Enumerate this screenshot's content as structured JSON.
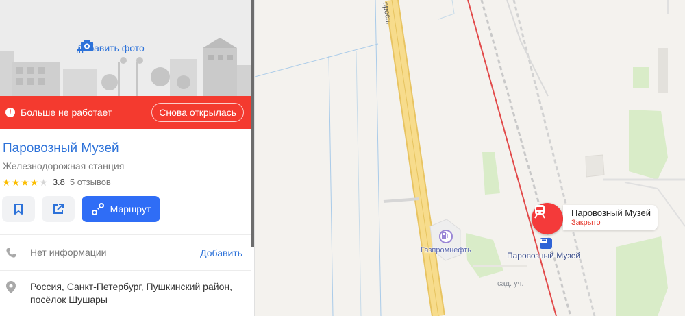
{
  "panel": {
    "add_photo": "Добавить фото",
    "status": {
      "closed_text": "Больше не работает",
      "reopened_button": "Снова открылась"
    },
    "title": "Паровозный Музей",
    "category": "Железнодорожная станция",
    "rating": {
      "value": "3.8",
      "stars_filled": 4,
      "stars_total": 5,
      "reviews": "5 отзывов"
    },
    "actions": {
      "bookmark_icon": "bookmark-icon",
      "share_icon": "share-icon",
      "route_label": "Маршрут"
    },
    "phone": {
      "text": "Нет информации",
      "add_label": "Добавить"
    },
    "address": "Россия, Санкт-Петербург, Пушкинский район, посёлок Шушары"
  },
  "map": {
    "road_label": "просп.",
    "poi_gas": "Газпромнефть",
    "station_label": "Паровозный Музей",
    "garden_label": "сад. уч.",
    "pin": {
      "title": "Паровозный Музей",
      "status": "Закрыто"
    }
  },
  "colors": {
    "accent": "#2d72d9",
    "closed_red": "#f43a2f",
    "route_blue": "#2f6df6",
    "star": "#fbbd00"
  }
}
